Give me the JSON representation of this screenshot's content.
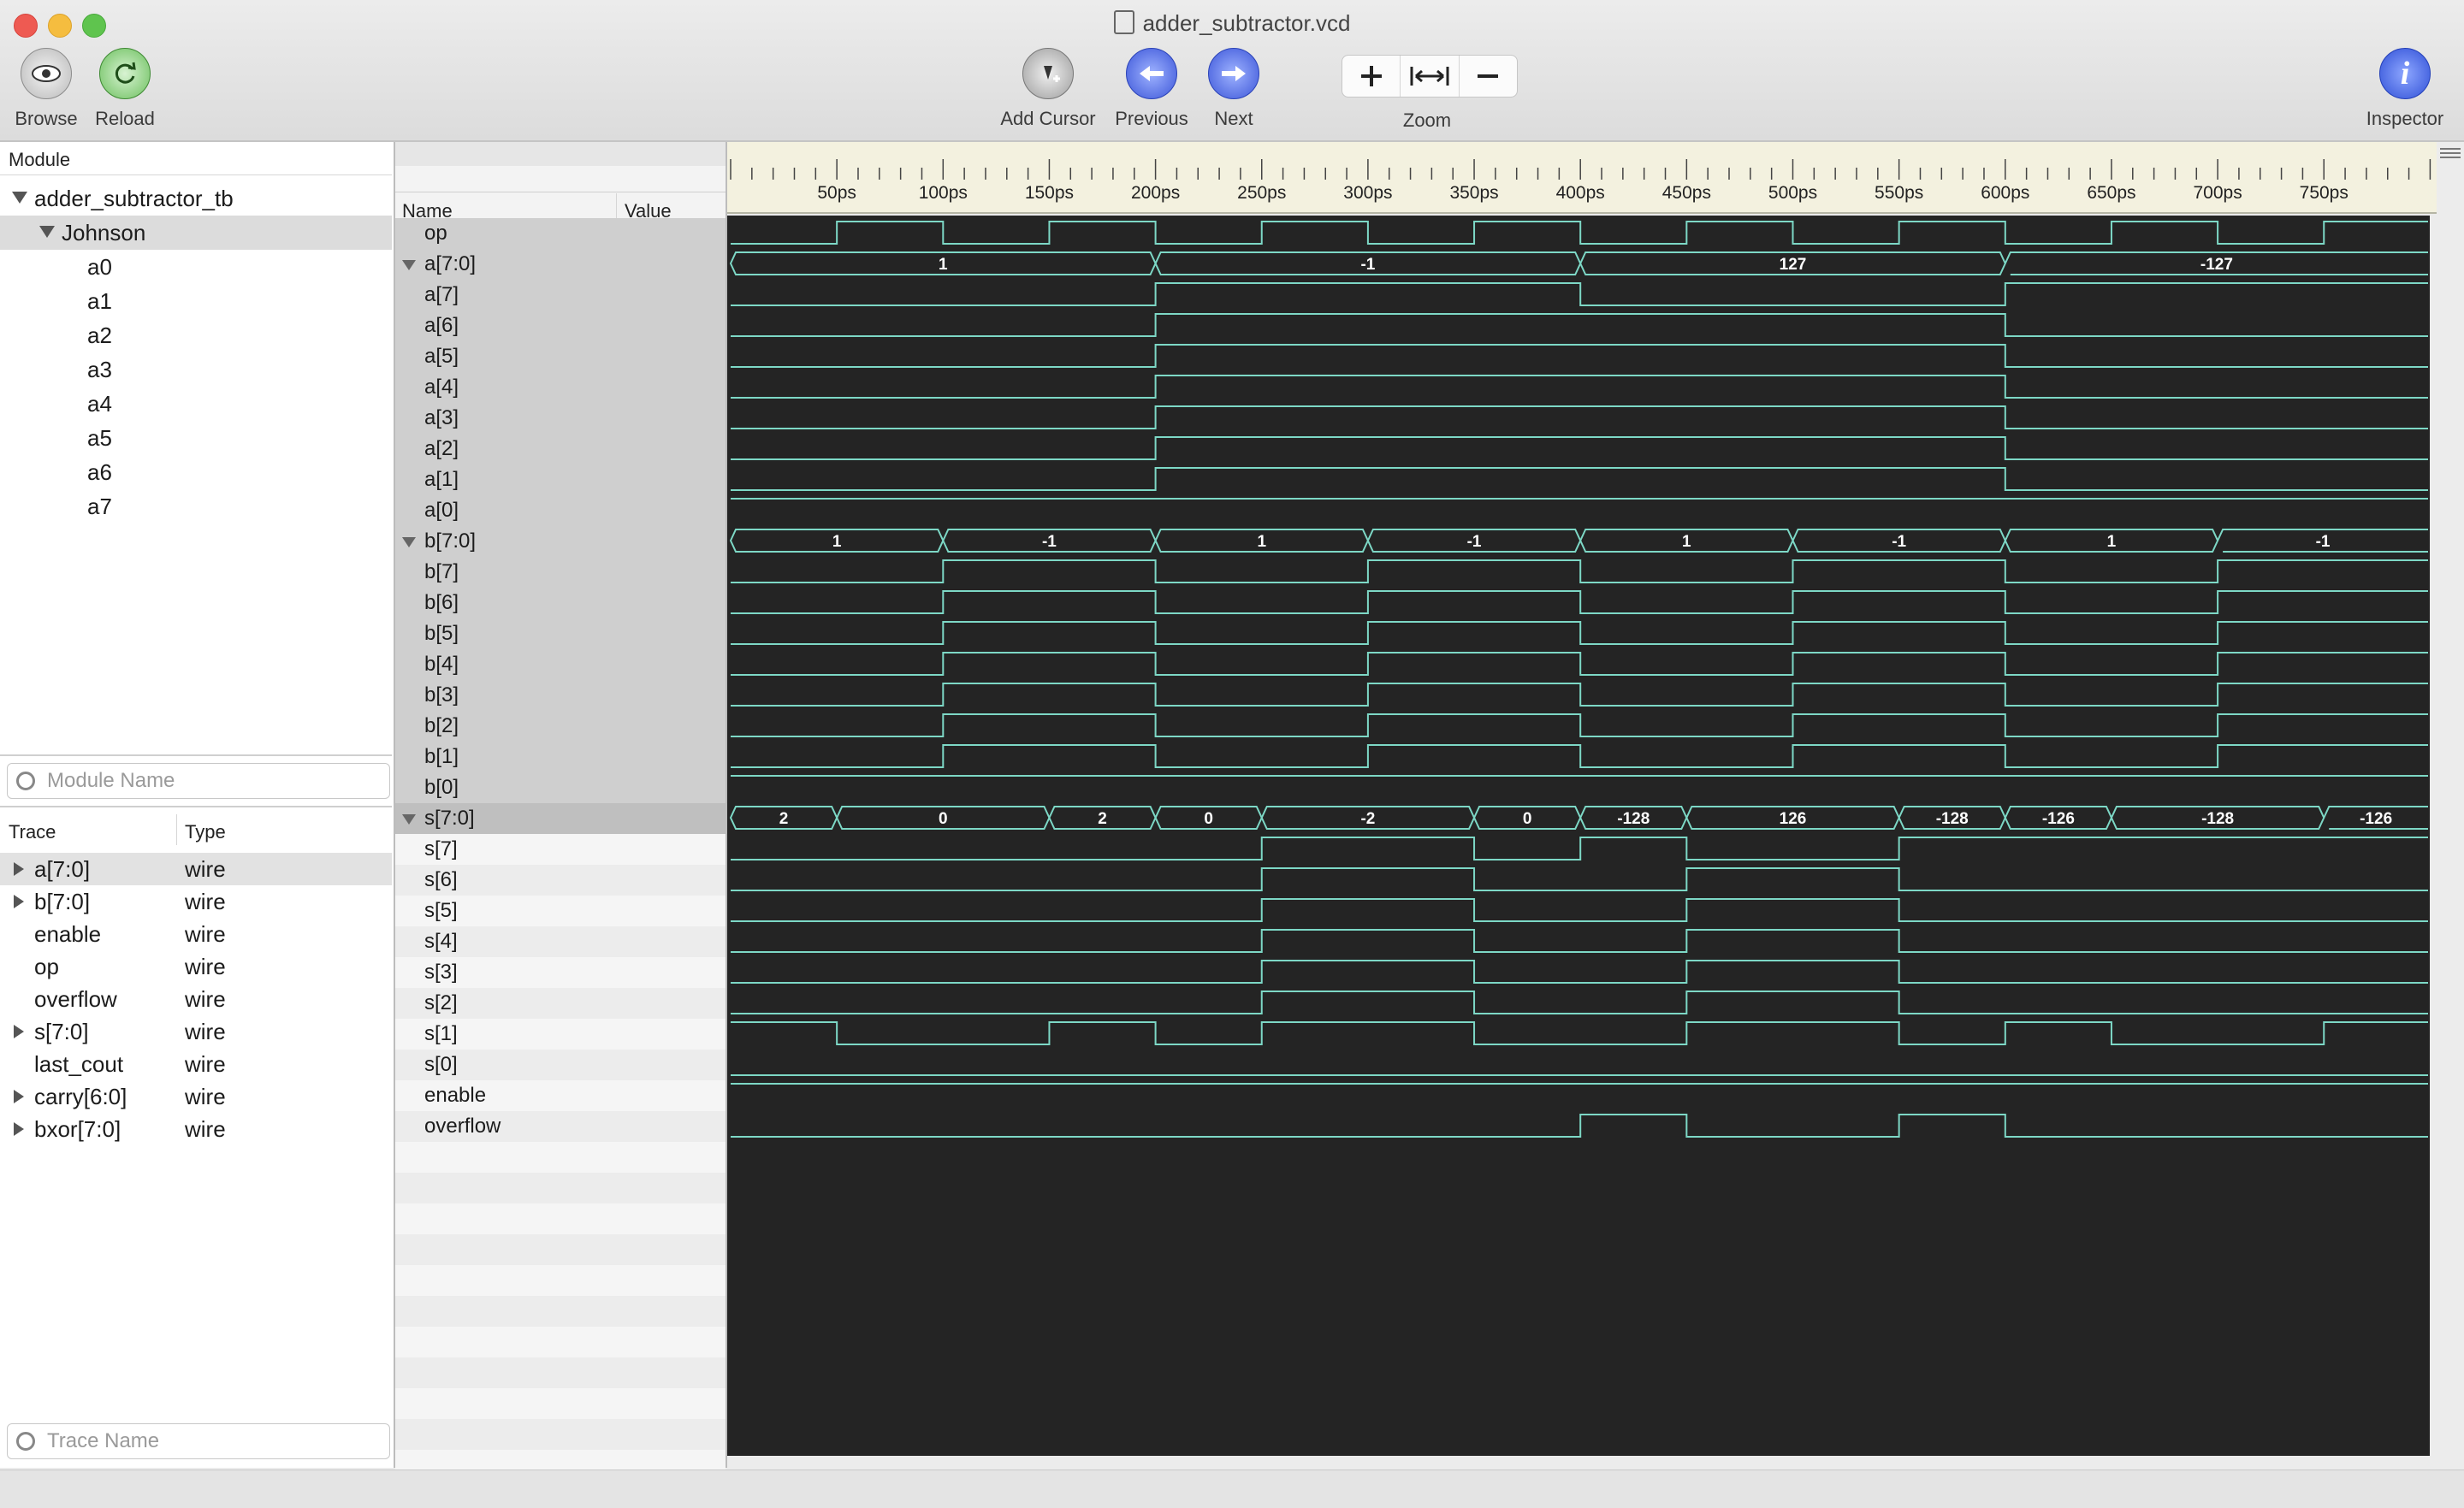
{
  "window": {
    "title": "adder_subtractor.vcd"
  },
  "toolbar": {
    "browse": "Browse",
    "reload": "Reload",
    "add_cursor": "Add Cursor",
    "previous": "Previous",
    "next": "Next",
    "zoom": "Zoom",
    "inspector": "Inspector"
  },
  "modules": {
    "header": "Module",
    "root": "adder_subtractor_tb",
    "child": "Johnson",
    "children": [
      "a0",
      "a1",
      "a2",
      "a3",
      "a4",
      "a5",
      "a6",
      "a7"
    ],
    "search_placeholder": "Module Name"
  },
  "traces": {
    "headers": {
      "trace": "Trace",
      "type": "Type"
    },
    "rows": [
      {
        "name": "a[7:0]",
        "type": "wire",
        "expandable": true
      },
      {
        "name": "b[7:0]",
        "type": "wire",
        "expandable": true
      },
      {
        "name": "enable",
        "type": "wire",
        "expandable": false
      },
      {
        "name": "op",
        "type": "wire",
        "expandable": false
      },
      {
        "name": "overflow",
        "type": "wire",
        "expandable": false
      },
      {
        "name": "s[7:0]",
        "type": "wire",
        "expandable": true
      },
      {
        "name": "last_cout",
        "type": "wire",
        "expandable": false
      },
      {
        "name": "carry[6:0]",
        "type": "wire",
        "expandable": true
      },
      {
        "name": "bxor[7:0]",
        "type": "wire",
        "expandable": true
      }
    ],
    "search_placeholder": "Trace Name"
  },
  "signals_header": {
    "name": "Name",
    "value": "Value"
  },
  "signals": [
    {
      "name": "op",
      "kind": "bit",
      "edges": [
        [
          0,
          0
        ],
        [
          50,
          1
        ],
        [
          100,
          0
        ],
        [
          150,
          1
        ],
        [
          200,
          0
        ],
        [
          250,
          1
        ],
        [
          300,
          0
        ],
        [
          350,
          1
        ],
        [
          400,
          0
        ],
        [
          450,
          1
        ],
        [
          500,
          0
        ],
        [
          550,
          1
        ],
        [
          600,
          0
        ],
        [
          650,
          1
        ],
        [
          700,
          0
        ],
        [
          750,
          1
        ]
      ]
    },
    {
      "name": "a[7:0]",
      "kind": "bus",
      "group": true,
      "segments": [
        [
          0,
          200,
          "1"
        ],
        [
          200,
          400,
          "-1"
        ],
        [
          400,
          600,
          "127"
        ],
        [
          600,
          800,
          "-127"
        ]
      ]
    },
    {
      "name": "a[7]",
      "kind": "bit",
      "edges": [
        [
          0,
          0
        ],
        [
          200,
          1
        ],
        [
          400,
          0
        ],
        [
          600,
          1
        ]
      ]
    },
    {
      "name": "a[6]",
      "kind": "bit",
      "edges": [
        [
          0,
          0
        ],
        [
          200,
          1
        ],
        [
          600,
          0
        ]
      ]
    },
    {
      "name": "a[5]",
      "kind": "bit",
      "edges": [
        [
          0,
          0
        ],
        [
          200,
          1
        ],
        [
          600,
          0
        ]
      ]
    },
    {
      "name": "a[4]",
      "kind": "bit",
      "edges": [
        [
          0,
          0
        ],
        [
          200,
          1
        ],
        [
          600,
          0
        ]
      ]
    },
    {
      "name": "a[3]",
      "kind": "bit",
      "edges": [
        [
          0,
          0
        ],
        [
          200,
          1
        ],
        [
          600,
          0
        ]
      ]
    },
    {
      "name": "a[2]",
      "kind": "bit",
      "edges": [
        [
          0,
          0
        ],
        [
          200,
          1
        ],
        [
          600,
          0
        ]
      ]
    },
    {
      "name": "a[1]",
      "kind": "bit",
      "edges": [
        [
          0,
          0
        ],
        [
          200,
          1
        ],
        [
          600,
          0
        ]
      ]
    },
    {
      "name": "a[0]",
      "kind": "bit",
      "edges": [
        [
          0,
          1
        ]
      ]
    },
    {
      "name": "b[7:0]",
      "kind": "bus",
      "group": true,
      "segments": [
        [
          0,
          100,
          "1"
        ],
        [
          100,
          200,
          "-1"
        ],
        [
          200,
          300,
          "1"
        ],
        [
          300,
          400,
          "-1"
        ],
        [
          400,
          500,
          "1"
        ],
        [
          500,
          600,
          "-1"
        ],
        [
          600,
          700,
          "1"
        ],
        [
          700,
          800,
          "-1"
        ]
      ]
    },
    {
      "name": "b[7]",
      "kind": "bit",
      "edges": [
        [
          0,
          0
        ],
        [
          100,
          1
        ],
        [
          200,
          0
        ],
        [
          300,
          1
        ],
        [
          400,
          0
        ],
        [
          500,
          1
        ],
        [
          600,
          0
        ],
        [
          700,
          1
        ]
      ]
    },
    {
      "name": "b[6]",
      "kind": "bit",
      "edges": [
        [
          0,
          0
        ],
        [
          100,
          1
        ],
        [
          200,
          0
        ],
        [
          300,
          1
        ],
        [
          400,
          0
        ],
        [
          500,
          1
        ],
        [
          600,
          0
        ],
        [
          700,
          1
        ]
      ]
    },
    {
      "name": "b[5]",
      "kind": "bit",
      "edges": [
        [
          0,
          0
        ],
        [
          100,
          1
        ],
        [
          200,
          0
        ],
        [
          300,
          1
        ],
        [
          400,
          0
        ],
        [
          500,
          1
        ],
        [
          600,
          0
        ],
        [
          700,
          1
        ]
      ]
    },
    {
      "name": "b[4]",
      "kind": "bit",
      "edges": [
        [
          0,
          0
        ],
        [
          100,
          1
        ],
        [
          200,
          0
        ],
        [
          300,
          1
        ],
        [
          400,
          0
        ],
        [
          500,
          1
        ],
        [
          600,
          0
        ],
        [
          700,
          1
        ]
      ]
    },
    {
      "name": "b[3]",
      "kind": "bit",
      "edges": [
        [
          0,
          0
        ],
        [
          100,
          1
        ],
        [
          200,
          0
        ],
        [
          300,
          1
        ],
        [
          400,
          0
        ],
        [
          500,
          1
        ],
        [
          600,
          0
        ],
        [
          700,
          1
        ]
      ]
    },
    {
      "name": "b[2]",
      "kind": "bit",
      "edges": [
        [
          0,
          0
        ],
        [
          100,
          1
        ],
        [
          200,
          0
        ],
        [
          300,
          1
        ],
        [
          400,
          0
        ],
        [
          500,
          1
        ],
        [
          600,
          0
        ],
        [
          700,
          1
        ]
      ]
    },
    {
      "name": "b[1]",
      "kind": "bit",
      "edges": [
        [
          0,
          0
        ],
        [
          100,
          1
        ],
        [
          200,
          0
        ],
        [
          300,
          1
        ],
        [
          400,
          0
        ],
        [
          500,
          1
        ],
        [
          600,
          0
        ],
        [
          700,
          1
        ]
      ]
    },
    {
      "name": "b[0]",
      "kind": "bit",
      "edges": [
        [
          0,
          1
        ]
      ]
    },
    {
      "name": "s[7:0]",
      "kind": "bus",
      "group": true,
      "segments": [
        [
          0,
          50,
          "2"
        ],
        [
          50,
          150,
          "0"
        ],
        [
          150,
          200,
          "2"
        ],
        [
          200,
          250,
          "0"
        ],
        [
          250,
          350,
          "-2"
        ],
        [
          350,
          400,
          "0"
        ],
        [
          400,
          450,
          "-128"
        ],
        [
          450,
          550,
          "126"
        ],
        [
          550,
          600,
          "-128"
        ],
        [
          600,
          650,
          "-126"
        ],
        [
          650,
          750,
          "-128"
        ],
        [
          750,
          800,
          "-126"
        ]
      ]
    },
    {
      "name": "s[7]",
      "kind": "bit",
      "edges": [
        [
          0,
          0
        ],
        [
          250,
          1
        ],
        [
          350,
          0
        ],
        [
          400,
          1
        ],
        [
          450,
          0
        ],
        [
          550,
          1
        ]
      ]
    },
    {
      "name": "s[6]",
      "kind": "bit",
      "edges": [
        [
          0,
          0
        ],
        [
          250,
          1
        ],
        [
          350,
          0
        ],
        [
          450,
          1
        ],
        [
          550,
          0
        ]
      ]
    },
    {
      "name": "s[5]",
      "kind": "bit",
      "edges": [
        [
          0,
          0
        ],
        [
          250,
          1
        ],
        [
          350,
          0
        ],
        [
          450,
          1
        ],
        [
          550,
          0
        ]
      ]
    },
    {
      "name": "s[4]",
      "kind": "bit",
      "edges": [
        [
          0,
          0
        ],
        [
          250,
          1
        ],
        [
          350,
          0
        ],
        [
          450,
          1
        ],
        [
          550,
          0
        ]
      ]
    },
    {
      "name": "s[3]",
      "kind": "bit",
      "edges": [
        [
          0,
          0
        ],
        [
          250,
          1
        ],
        [
          350,
          0
        ],
        [
          450,
          1
        ],
        [
          550,
          0
        ]
      ]
    },
    {
      "name": "s[2]",
      "kind": "bit",
      "edges": [
        [
          0,
          0
        ],
        [
          250,
          1
        ],
        [
          350,
          0
        ],
        [
          450,
          1
        ],
        [
          550,
          0
        ]
      ]
    },
    {
      "name": "s[1]",
      "kind": "bit",
      "edges": [
        [
          0,
          1
        ],
        [
          50,
          0
        ],
        [
          150,
          1
        ],
        [
          200,
          0
        ],
        [
          250,
          1
        ],
        [
          350,
          0
        ],
        [
          450,
          1
        ],
        [
          550,
          0
        ],
        [
          600,
          1
        ],
        [
          650,
          0
        ],
        [
          750,
          1
        ]
      ]
    },
    {
      "name": "s[0]",
      "kind": "bit",
      "edges": [
        [
          0,
          0
        ]
      ]
    },
    {
      "name": "enable",
      "kind": "bit",
      "edges": [
        [
          0,
          1
        ]
      ]
    },
    {
      "name": "overflow",
      "kind": "bit",
      "edges": [
        [
          0,
          0
        ],
        [
          400,
          1
        ],
        [
          450,
          0
        ],
        [
          550,
          1
        ],
        [
          600,
          0
        ]
      ]
    }
  ],
  "ruler": {
    "labels": [
      "50ps",
      "100ps",
      "150ps",
      "200ps",
      "250ps",
      "300ps",
      "350ps",
      "400ps",
      "450ps",
      "500ps",
      "550ps",
      "600ps",
      "650ps",
      "700ps",
      "750ps"
    ]
  },
  "colors": {
    "wave": "#7dd8c6",
    "wave_bg": "#242424",
    "ruler_bg": "#f3f1df",
    "accent": "#3b5bd6"
  }
}
